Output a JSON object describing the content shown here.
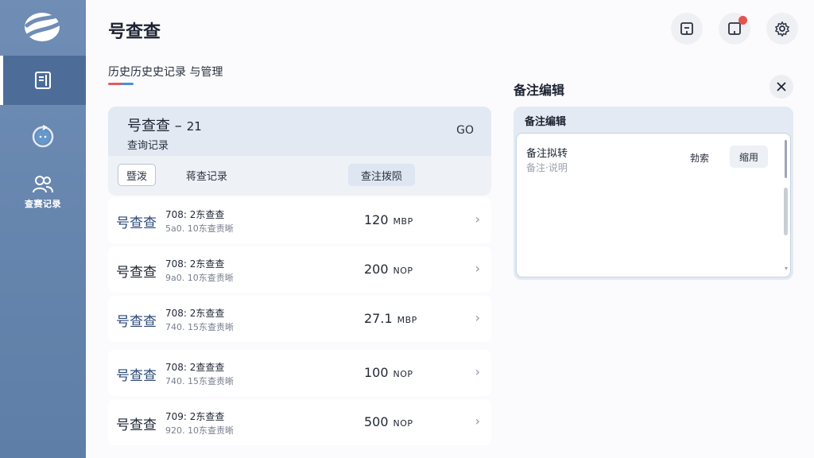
{
  "app": {
    "title": "号查查"
  },
  "sidebar": {
    "items": [
      {
        "icon": "document-icon",
        "active": true
      },
      {
        "icon": "refresh-clock-icon",
        "active": false
      },
      {
        "icon": "users-icon",
        "label": "查赛记录",
        "active": false
      }
    ]
  },
  "header": {
    "subtitle": "历史历史史记录 与管理",
    "icons": [
      "message-icon",
      "notification-icon",
      "settings-icon"
    ]
  },
  "query_card": {
    "title": "号查查 –",
    "number": "21",
    "subtitle": "查询记录",
    "go_label": "GO",
    "btn_a": "暨泼",
    "btn_b": "蒋查记录",
    "btn_c": "查注拨陨"
  },
  "rows": [
    {
      "name": "号查查",
      "line1": "708: 2东查查",
      "line2": "5a0. 10东查责晰",
      "value": "120",
      "unit": "MBP",
      "highlight": true
    },
    {
      "name": "号查查",
      "line1": "708: 2东查查",
      "line2": "9a0. 10东查责晰",
      "value": "200",
      "unit": "NOP",
      "highlight": false
    },
    {
      "name": "号查查",
      "line1": "708: 2东查查",
      "line2": "740. 15东查责晰",
      "value": "27.1",
      "unit": "MBP",
      "highlight": true
    },
    {
      "name": "号查查",
      "line1": "708: 2查查查",
      "line2": "740. 15东查责晰",
      "value": "100",
      "unit": "NOP",
      "highlight": true
    },
    {
      "name": "号查查",
      "line1": "709: 2东查查",
      "line2": "920. 10东查责晰",
      "value": "500",
      "unit": "NOP",
      "highlight": false
    }
  ],
  "notes": {
    "title": "备注编辑",
    "panel_head": "备注编辑",
    "label": "备注拟转",
    "placeholder": "备注·说明",
    "search": "勃索",
    "toggle": "缩用"
  },
  "colors": {
    "sidebar": "#6f8db5",
    "accent_red": "#e4534f",
    "accent_blue": "#4a8de0",
    "highlight_name": "#2c4a78"
  }
}
